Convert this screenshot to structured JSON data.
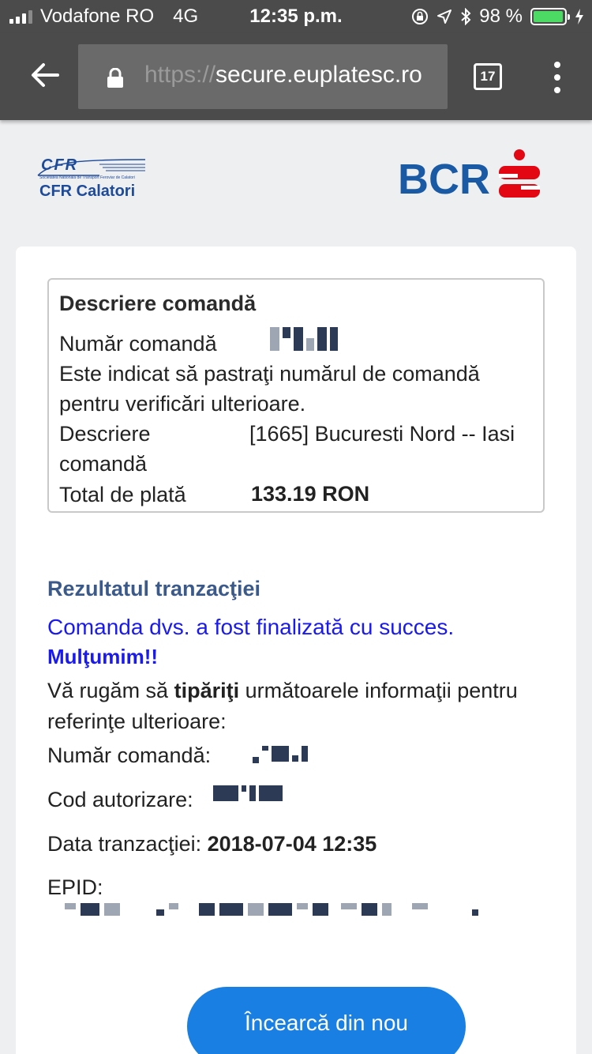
{
  "status_bar": {
    "carrier": "Vodafone RO",
    "network": "4G",
    "time": "12:35 p.m.",
    "battery": "98 %",
    "battery_level": 0.98
  },
  "browser": {
    "url_prefix": "https://",
    "url_host": "secure.euplatesc.ro",
    "tab_count": "17"
  },
  "header": {
    "cfr_mark": "CFR",
    "cfr_subtitle": "Societatea Nationala de Transport Feroviar de Calatori",
    "cfr_name": "CFR Calatori",
    "bank_name": "BCR"
  },
  "order": {
    "title": "Descriere comandă",
    "number_label": "Număr comandă",
    "note": "Este indicat să pastraţi numărul de comandă pentru verificări ulterioare.",
    "desc_label": "Descriere comandă",
    "desc_value": "[1665] Bucuresti Nord -- Iasi",
    "total_label": "Total de plată",
    "total_value": "133.19 RON"
  },
  "result": {
    "title": "Rezultatul tranzacţiei",
    "success": "Comanda dvs. a fost finalizată cu succes.",
    "thanks": "Mulţumim!!",
    "print_pre": "Vă rugăm să ",
    "print_bold": "tipăriţi",
    "print_post": " următoarele informaţii pentru referinţe ulterioare:",
    "number_label": "Număr comandă:",
    "auth_label": "Cod autorizare:",
    "date_label": "Data tranzacţiei:",
    "date_value": "2018-07-04 12:35",
    "epid_label": "EPID:"
  },
  "actions": {
    "retry_label": "Încearcă din nou"
  },
  "colors": {
    "accent_blue": "#1a7fe3",
    "success_blue": "#1a1aee",
    "heading_blue": "#3b5a8a",
    "bcr_blue": "#1a5aa5",
    "bcr_red": "#e30613",
    "toolbar_gray": "#4b4b4b"
  }
}
